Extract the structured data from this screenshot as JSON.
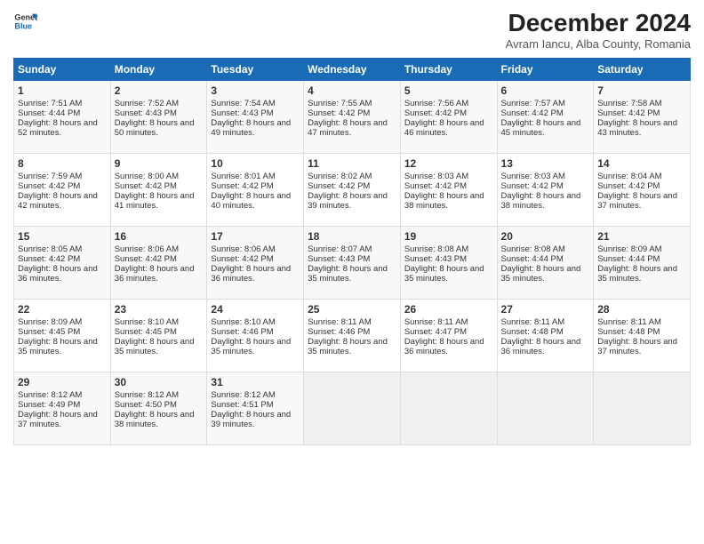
{
  "header": {
    "logo_line1": "General",
    "logo_line2": "Blue",
    "month": "December 2024",
    "location": "Avram Iancu, Alba County, Romania"
  },
  "days_of_week": [
    "Sunday",
    "Monday",
    "Tuesday",
    "Wednesday",
    "Thursday",
    "Friday",
    "Saturday"
  ],
  "weeks": [
    [
      {
        "day": "1",
        "sunrise": "Sunrise: 7:51 AM",
        "sunset": "Sunset: 4:44 PM",
        "daylight": "Daylight: 8 hours and 52 minutes."
      },
      {
        "day": "2",
        "sunrise": "Sunrise: 7:52 AM",
        "sunset": "Sunset: 4:43 PM",
        "daylight": "Daylight: 8 hours and 50 minutes."
      },
      {
        "day": "3",
        "sunrise": "Sunrise: 7:54 AM",
        "sunset": "Sunset: 4:43 PM",
        "daylight": "Daylight: 8 hours and 49 minutes."
      },
      {
        "day": "4",
        "sunrise": "Sunrise: 7:55 AM",
        "sunset": "Sunset: 4:42 PM",
        "daylight": "Daylight: 8 hours and 47 minutes."
      },
      {
        "day": "5",
        "sunrise": "Sunrise: 7:56 AM",
        "sunset": "Sunset: 4:42 PM",
        "daylight": "Daylight: 8 hours and 46 minutes."
      },
      {
        "day": "6",
        "sunrise": "Sunrise: 7:57 AM",
        "sunset": "Sunset: 4:42 PM",
        "daylight": "Daylight: 8 hours and 45 minutes."
      },
      {
        "day": "7",
        "sunrise": "Sunrise: 7:58 AM",
        "sunset": "Sunset: 4:42 PM",
        "daylight": "Daylight: 8 hours and 43 minutes."
      }
    ],
    [
      {
        "day": "8",
        "sunrise": "Sunrise: 7:59 AM",
        "sunset": "Sunset: 4:42 PM",
        "daylight": "Daylight: 8 hours and 42 minutes."
      },
      {
        "day": "9",
        "sunrise": "Sunrise: 8:00 AM",
        "sunset": "Sunset: 4:42 PM",
        "daylight": "Daylight: 8 hours and 41 minutes."
      },
      {
        "day": "10",
        "sunrise": "Sunrise: 8:01 AM",
        "sunset": "Sunset: 4:42 PM",
        "daylight": "Daylight: 8 hours and 40 minutes."
      },
      {
        "day": "11",
        "sunrise": "Sunrise: 8:02 AM",
        "sunset": "Sunset: 4:42 PM",
        "daylight": "Daylight: 8 hours and 39 minutes."
      },
      {
        "day": "12",
        "sunrise": "Sunrise: 8:03 AM",
        "sunset": "Sunset: 4:42 PM",
        "daylight": "Daylight: 8 hours and 38 minutes."
      },
      {
        "day": "13",
        "sunrise": "Sunrise: 8:03 AM",
        "sunset": "Sunset: 4:42 PM",
        "daylight": "Daylight: 8 hours and 38 minutes."
      },
      {
        "day": "14",
        "sunrise": "Sunrise: 8:04 AM",
        "sunset": "Sunset: 4:42 PM",
        "daylight": "Daylight: 8 hours and 37 minutes."
      }
    ],
    [
      {
        "day": "15",
        "sunrise": "Sunrise: 8:05 AM",
        "sunset": "Sunset: 4:42 PM",
        "daylight": "Daylight: 8 hours and 36 minutes."
      },
      {
        "day": "16",
        "sunrise": "Sunrise: 8:06 AM",
        "sunset": "Sunset: 4:42 PM",
        "daylight": "Daylight: 8 hours and 36 minutes."
      },
      {
        "day": "17",
        "sunrise": "Sunrise: 8:06 AM",
        "sunset": "Sunset: 4:42 PM",
        "daylight": "Daylight: 8 hours and 36 minutes."
      },
      {
        "day": "18",
        "sunrise": "Sunrise: 8:07 AM",
        "sunset": "Sunset: 4:43 PM",
        "daylight": "Daylight: 8 hours and 35 minutes."
      },
      {
        "day": "19",
        "sunrise": "Sunrise: 8:08 AM",
        "sunset": "Sunset: 4:43 PM",
        "daylight": "Daylight: 8 hours and 35 minutes."
      },
      {
        "day": "20",
        "sunrise": "Sunrise: 8:08 AM",
        "sunset": "Sunset: 4:44 PM",
        "daylight": "Daylight: 8 hours and 35 minutes."
      },
      {
        "day": "21",
        "sunrise": "Sunrise: 8:09 AM",
        "sunset": "Sunset: 4:44 PM",
        "daylight": "Daylight: 8 hours and 35 minutes."
      }
    ],
    [
      {
        "day": "22",
        "sunrise": "Sunrise: 8:09 AM",
        "sunset": "Sunset: 4:45 PM",
        "daylight": "Daylight: 8 hours and 35 minutes."
      },
      {
        "day": "23",
        "sunrise": "Sunrise: 8:10 AM",
        "sunset": "Sunset: 4:45 PM",
        "daylight": "Daylight: 8 hours and 35 minutes."
      },
      {
        "day": "24",
        "sunrise": "Sunrise: 8:10 AM",
        "sunset": "Sunset: 4:46 PM",
        "daylight": "Daylight: 8 hours and 35 minutes."
      },
      {
        "day": "25",
        "sunrise": "Sunrise: 8:11 AM",
        "sunset": "Sunset: 4:46 PM",
        "daylight": "Daylight: 8 hours and 35 minutes."
      },
      {
        "day": "26",
        "sunrise": "Sunrise: 8:11 AM",
        "sunset": "Sunset: 4:47 PM",
        "daylight": "Daylight: 8 hours and 36 minutes."
      },
      {
        "day": "27",
        "sunrise": "Sunrise: 8:11 AM",
        "sunset": "Sunset: 4:48 PM",
        "daylight": "Daylight: 8 hours and 36 minutes."
      },
      {
        "day": "28",
        "sunrise": "Sunrise: 8:11 AM",
        "sunset": "Sunset: 4:48 PM",
        "daylight": "Daylight: 8 hours and 37 minutes."
      }
    ],
    [
      {
        "day": "29",
        "sunrise": "Sunrise: 8:12 AM",
        "sunset": "Sunset: 4:49 PM",
        "daylight": "Daylight: 8 hours and 37 minutes."
      },
      {
        "day": "30",
        "sunrise": "Sunrise: 8:12 AM",
        "sunset": "Sunset: 4:50 PM",
        "daylight": "Daylight: 8 hours and 38 minutes."
      },
      {
        "day": "31",
        "sunrise": "Sunrise: 8:12 AM",
        "sunset": "Sunset: 4:51 PM",
        "daylight": "Daylight: 8 hours and 39 minutes."
      },
      null,
      null,
      null,
      null
    ]
  ]
}
